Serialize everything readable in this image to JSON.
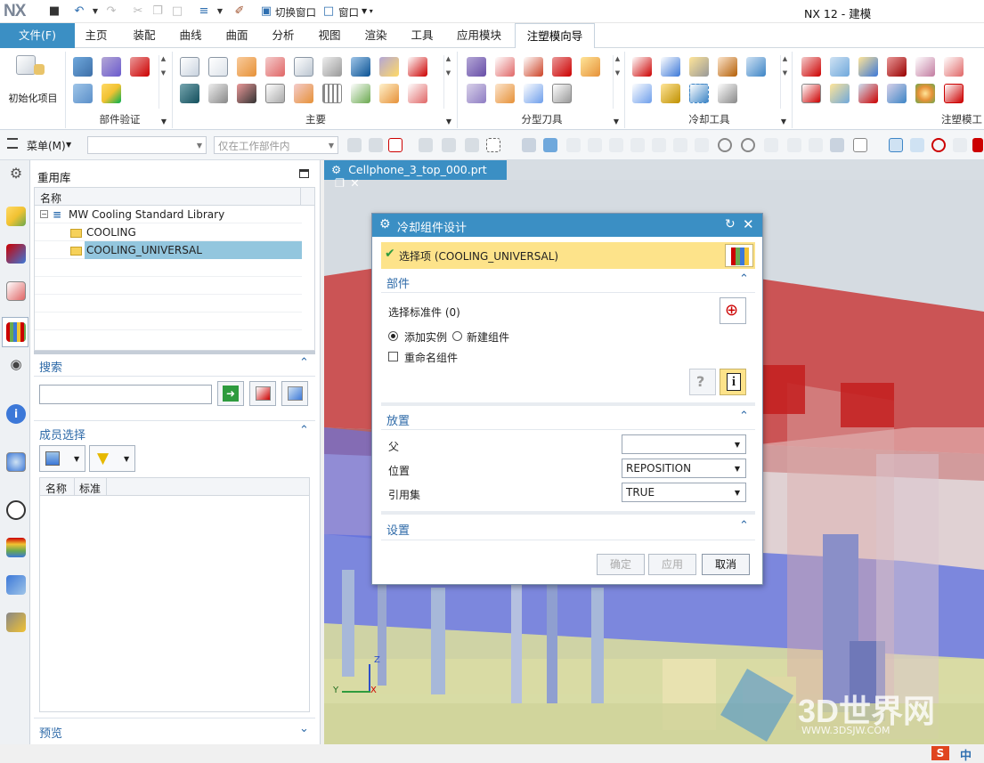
{
  "app": {
    "logo": "NX",
    "window_title": "NX 12 - 建模",
    "switch_window": "切换窗口",
    "window_menu": "窗口"
  },
  "ribbon_tabs": {
    "file": "文件(F)",
    "items": [
      "主页",
      "装配",
      "曲线",
      "曲面",
      "分析",
      "视图",
      "渲染",
      "工具",
      "应用模块",
      "注塑模向导"
    ],
    "active": "注塑模向导"
  },
  "ribbon": {
    "init_project": "初始化项目",
    "groups": [
      "部件验证",
      "主要",
      "分型刀具",
      "冷却工具",
      "注塑模工"
    ]
  },
  "command_bar": {
    "menu": "菜单(M)",
    "filter_placeholder": "",
    "scope": "仅在工作部件内"
  },
  "reuse_library": {
    "title": "重用库",
    "column": "名称",
    "tree": {
      "root": "MW Cooling Standard Library",
      "children": [
        "COOLING",
        "COOLING_UNIVERSAL"
      ],
      "selected": "COOLING_UNIVERSAL"
    },
    "search_title": "搜索",
    "search_value": "",
    "member_title": "成员选择",
    "member_columns": [
      "名称",
      "标准"
    ],
    "preview_title": "预览"
  },
  "document_tab": "Cellphone_3_top_000.prt",
  "dialog": {
    "title": "冷却组件设计",
    "selection": "选择项 (COOLING_UNIVERSAL)",
    "section_part": "部件",
    "select_std": "选择标准件 (0)",
    "radio_add": "添加实例",
    "radio_new": "新建组件",
    "radio_selected": "添加实例",
    "checkbox_rename": "重命名组件",
    "section_placement": "放置",
    "parent_label": "父",
    "parent_value": "",
    "position_label": "位置",
    "position_value": "REPOSITION",
    "refset_label": "引用集",
    "refset_value": "TRUE",
    "section_settings": "设置",
    "btn_ok": "确定",
    "btn_apply": "应用",
    "btn_cancel": "取消"
  },
  "watermark": {
    "text": "3D世界网",
    "url": "WWW.3DSJW.COM"
  },
  "taskbar": {
    "ime": "中"
  },
  "axes": {
    "y": "Y",
    "x": "X",
    "z": "Z"
  }
}
